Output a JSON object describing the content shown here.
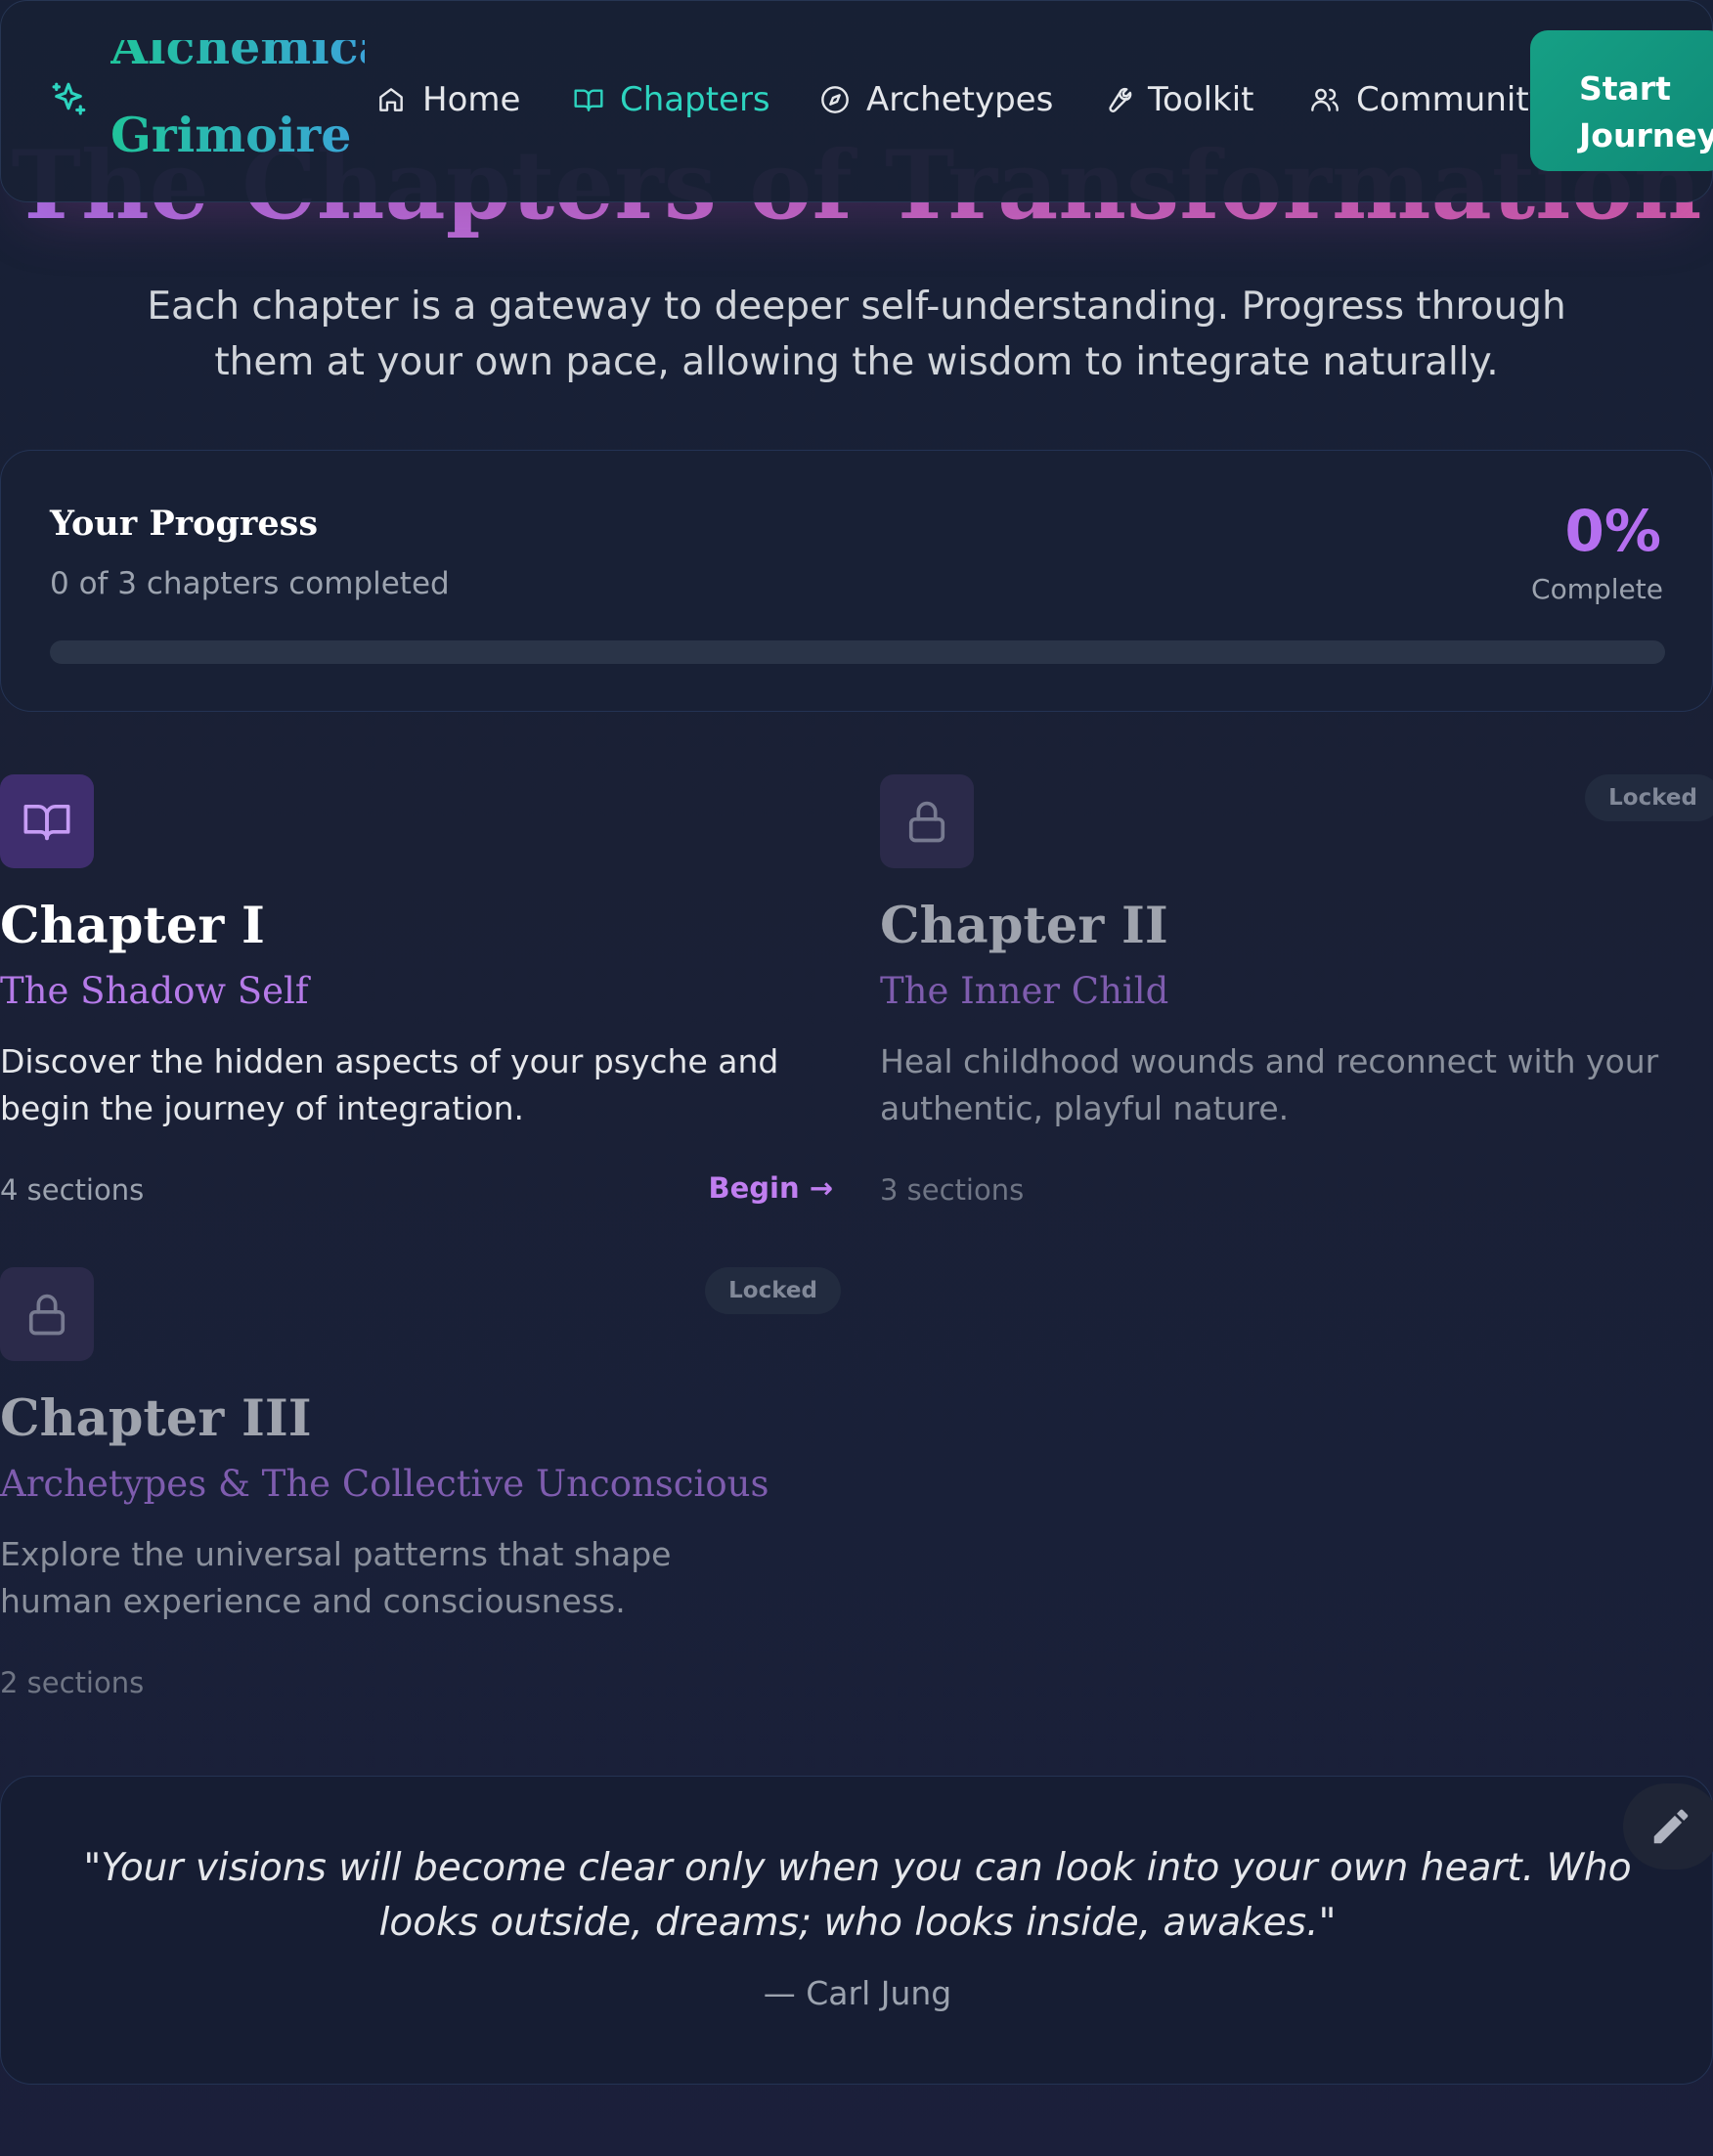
{
  "header": {
    "logo_line1": "Alchemical",
    "logo_line2": "Grimoire",
    "logo_icon": "sparkles-icon",
    "nav": [
      {
        "label": "Home",
        "icon": "home-icon",
        "active": false
      },
      {
        "label": "Chapters",
        "icon": "book-open-icon",
        "active": true
      },
      {
        "label": "Archetypes",
        "icon": "compass-icon",
        "active": false
      },
      {
        "label": "Toolkit",
        "icon": "wrench-icon",
        "active": false
      },
      {
        "label": "Community",
        "icon": "users-icon",
        "active": false
      }
    ],
    "cta_line1": "Start",
    "cta_line2": "Journey"
  },
  "page": {
    "title": "The Chapters of Transformation",
    "subtitle": "Each chapter is a gateway to deeper self-understanding. Progress through them at your own pace, allowing the wisdom to integrate naturally."
  },
  "progress": {
    "title": "Your Progress",
    "summary": "0 of 3 chapters completed",
    "percent_label": "0%",
    "complete_label": "Complete",
    "fraction": 0
  },
  "chapters": [
    {
      "title": "Chapter I",
      "subtitle": "The Shadow Self",
      "description": "Discover the hidden aspects of your psyche and begin the journey of integration.",
      "sections": "4 sections",
      "action": "Begin →",
      "locked": false,
      "icon": "book-open-icon"
    },
    {
      "title": "Chapter II",
      "subtitle": "The Inner Child",
      "description": "Heal childhood wounds and reconnect with your authentic, playful nature.",
      "sections": "3 sections",
      "badge": "Locked",
      "locked": true,
      "icon": "lock-icon"
    },
    {
      "title": "Chapter III",
      "subtitle": "Archetypes & The Collective Unconscious",
      "description": "Explore the universal patterns that shape human experience and consciousness.",
      "sections": "2 sections",
      "badge": "Locked",
      "locked": true,
      "icon": "lock-icon"
    }
  ],
  "quote": {
    "text": "\"Your visions will become clear only when you can look into your own heart. Who looks outside, dreams; who looks inside, awakes.\"",
    "author": "— Carl Jung"
  },
  "colors": {
    "accent_teal": "#2dd4bf",
    "accent_purple": "#b56ff0",
    "background": "#1a2035",
    "cta": "#16a085"
  }
}
